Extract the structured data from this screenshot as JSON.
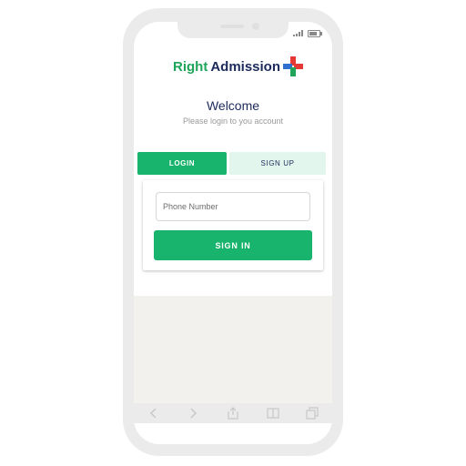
{
  "brand": {
    "name_part1": "Right",
    "name_part2": "Admission",
    "colors": {
      "green": "#1fa45a",
      "navy": "#1c2a5b",
      "red": "#e53935",
      "blue": "#2f6fd0"
    }
  },
  "header": {
    "title": "Welcome",
    "subtitle": "Please login to you account"
  },
  "tabs": [
    {
      "label": "LOGIN",
      "active": true
    },
    {
      "label": "SIGN UP",
      "active": false
    }
  ],
  "form": {
    "phone_placeholder": "Phone Number",
    "phone_value": "",
    "submit_label": "SIGN IN"
  },
  "browser_toolbar": {
    "icons": [
      "back-icon",
      "forward-icon",
      "share-icon",
      "bookmarks-icon",
      "tabs-icon"
    ]
  },
  "status_bar": {
    "icons": [
      "signal-icon",
      "battery-icon"
    ]
  },
  "colors": {
    "accent": "#18b36c",
    "tab_inactive_bg": "#e3f6ed"
  }
}
